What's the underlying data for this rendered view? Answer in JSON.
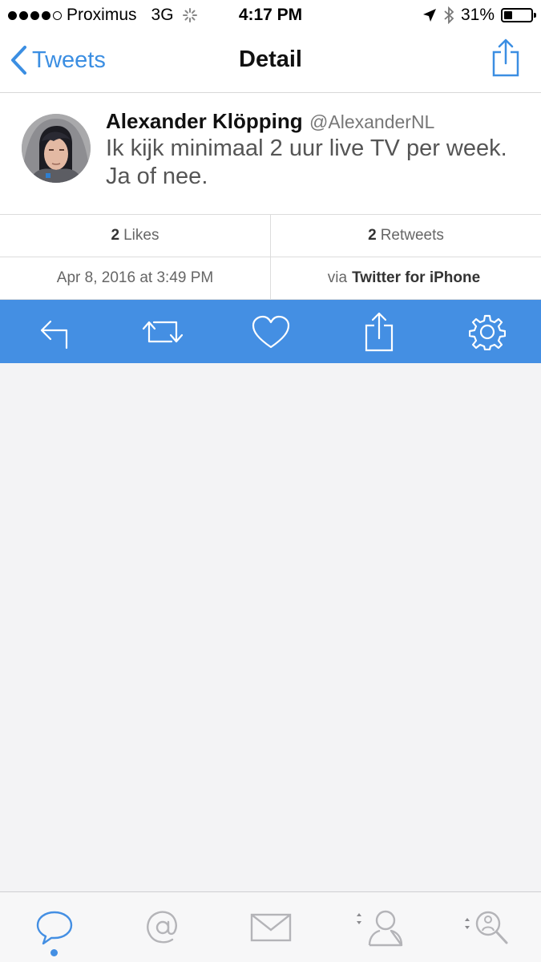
{
  "status_bar": {
    "carrier": "Proximus",
    "network": "3G",
    "time": "4:17 PM",
    "battery": "31%",
    "battery_level": 0.31
  },
  "nav": {
    "back_label": "Tweets",
    "title": "Detail"
  },
  "tweet": {
    "author_name": "Alexander Klöpping",
    "author_handle": "@AlexanderNL",
    "text": "Ik kijk minimaal 2 uur live TV per week. Ja of nee.",
    "likes_count": "2",
    "likes_label": "Likes",
    "retweets_count": "2",
    "retweets_label": "Retweets",
    "timestamp": "Apr 8, 2016 at 3:49 PM",
    "via_prefix": "via",
    "client": "Twitter for iPhone"
  },
  "colors": {
    "accent": "#448fe3",
    "link": "#3b8ee2"
  },
  "action_bar": [
    "reply-icon",
    "retweet-icon",
    "heart-icon",
    "share-icon",
    "gear-icon"
  ],
  "tab_bar": [
    "chat-bubble-icon",
    "mention-icon",
    "mail-icon",
    "profile-icon",
    "search-icon"
  ]
}
